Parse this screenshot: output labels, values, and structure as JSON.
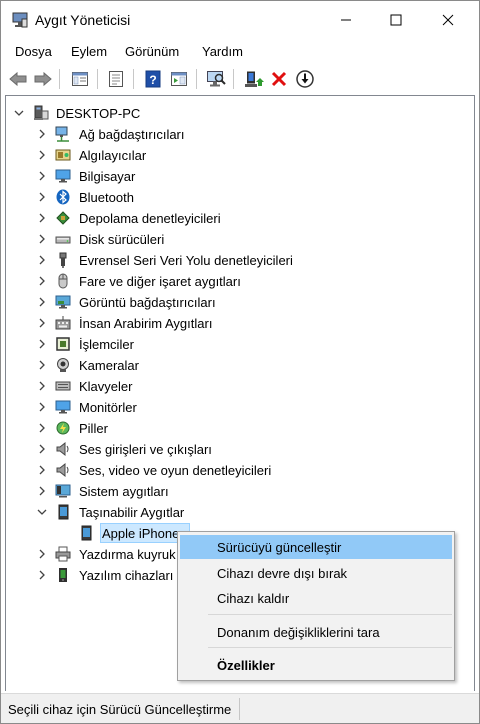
{
  "window": {
    "title": "Aygıt Yöneticisi"
  },
  "menubar": {
    "items": [
      "Dosya",
      "Eylem",
      "Görünüm",
      "Yardım"
    ]
  },
  "toolbar": {
    "buttons": [
      "back-arrow-icon",
      "forward-arrow-icon",
      "properties-list-icon",
      "show-hide-console-tree-icon",
      "help-icon",
      "action-pane-icon",
      "scan-hardware-icon",
      "update-driver-icon",
      "uninstall-device-icon",
      "disable-device-icon"
    ]
  },
  "tree": {
    "root": "DESKTOP-PC",
    "categories": [
      "Ağ bağdaştırıcıları",
      "Algılayıcılar",
      "Bilgisayar",
      "Bluetooth",
      "Depolama denetleyicileri",
      "Disk sürücüleri",
      "Evrensel Seri Veri Yolu denetleyicileri",
      "Fare ve diğer işaret aygıtları",
      "Görüntü bağdaştırıcıları",
      "İnsan Arabirim Aygıtları",
      "İşlemciler",
      "Kameralar",
      "Klavyeler",
      "Monitörler",
      "Piller",
      "Ses girişleri ve çıkışları",
      "Ses, video ve oyun denetleyicileri",
      "Sistem aygıtları",
      "Taşınabilir Aygıtlar"
    ],
    "expanded_child": "Apple iPhone",
    "after_categories": [
      "Yazdırma kuyruk",
      "Yazılım cihazları"
    ]
  },
  "context_menu": {
    "items": [
      "Sürücüyü güncelleştir",
      "Cihazı devre dışı bırak",
      "Cihazı kaldır",
      "Donanım değişikliklerini tara",
      "Özellikler"
    ],
    "highlighted": "Sürücüyü güncelleştir"
  },
  "statusbar": {
    "text": "Seçili cihaz için Sürücü Güncelleştirme"
  },
  "colors": {
    "selection": "#cce8ff",
    "menu_highlight": "#91c9f7",
    "remove_red": "#e01010"
  }
}
